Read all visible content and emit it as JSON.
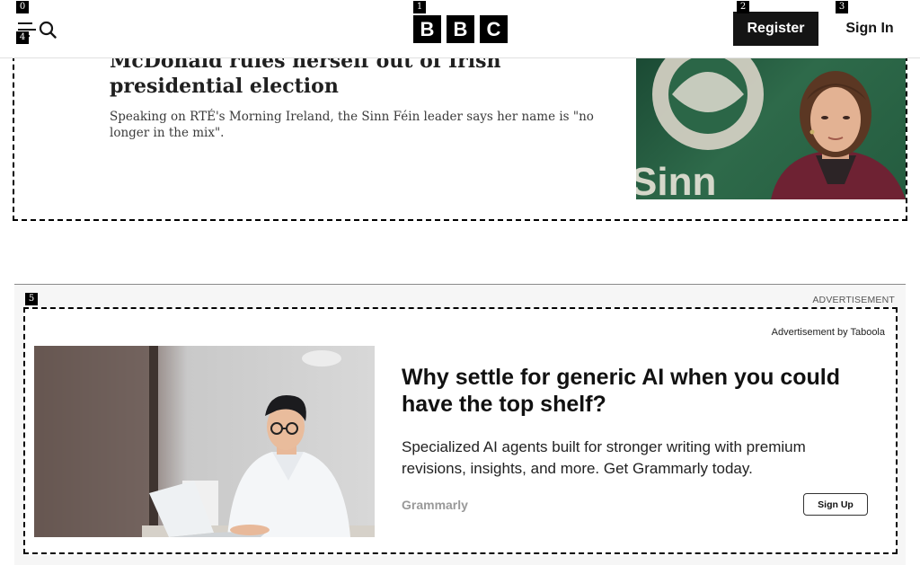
{
  "header": {
    "logo_letters": [
      "B",
      "B",
      "C"
    ],
    "register_label": "Register",
    "signin_label": "Sign In",
    "icons": [
      "menu-icon",
      "search-icon"
    ]
  },
  "article": {
    "headline": "McDonald rules herself out of Irish presidential election",
    "summary": "Speaking on RTÉ's Morning Ireland, the Sinn Féin leader says her name is \"no longer in the mix\".",
    "image_text": "Sinn"
  },
  "ad": {
    "section_label": "ADVERTISEMENT",
    "by_label": "Advertisement by Taboola",
    "title": "Why settle for generic AI when you could have the top shelf?",
    "description": "Specialized AI agents built for stronger writing with premium revisions, insights, and more. Get Grammarly today.",
    "brand": "Grammarly",
    "cta_label": "Sign Up"
  },
  "annotations": [
    "0",
    "1",
    "2",
    "3",
    "4",
    "5"
  ]
}
